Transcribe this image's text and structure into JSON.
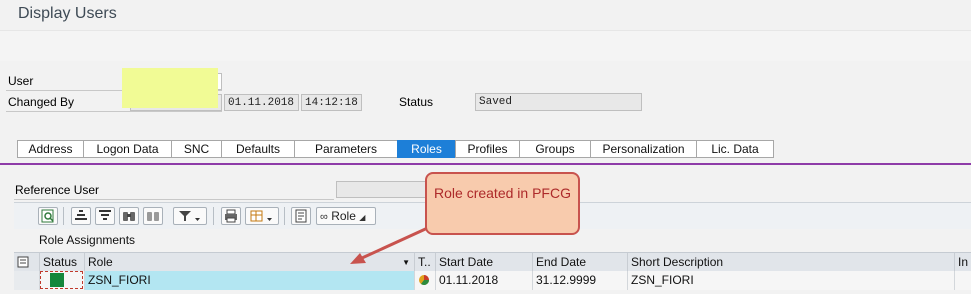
{
  "window": {
    "title": "Display Users"
  },
  "header": {
    "user_label": "User",
    "changed_by_label": "Changed By",
    "changed_date": "01.11.2018",
    "changed_time": "14:12:18",
    "status_label": "Status",
    "status_value": "Saved"
  },
  "tabs": [
    {
      "label": "Address"
    },
    {
      "label": "Logon Data"
    },
    {
      "label": "SNC"
    },
    {
      "label": "Defaults"
    },
    {
      "label": "Parameters"
    },
    {
      "label": "Roles"
    },
    {
      "label": "Profiles"
    },
    {
      "label": "Groups"
    },
    {
      "label": "Personalization"
    },
    {
      "label": "Lic. Data"
    }
  ],
  "active_tab": "Roles",
  "reference_user": {
    "label": "Reference User"
  },
  "toolbar": {
    "role_button_label": "Role"
  },
  "section_title": "Role Assignments",
  "table": {
    "headers": [
      "Status",
      "Role",
      "T..",
      "Start Date",
      "End Date",
      "Short Description",
      "In"
    ],
    "rows": [
      {
        "role": "ZSN_FIORI",
        "start_date": "01.11.2018",
        "end_date": "31.12.9999",
        "short_description": "ZSN_FIORI"
      }
    ]
  },
  "annotation": {
    "text": "Role created in PFCG"
  },
  "colors": {
    "active_tab": "#1d7fd8",
    "tab_separator": "#8e3ca8",
    "highlight": "#f1fb95",
    "status_green": "#14873c",
    "row_highlight": "#b3e6f2",
    "callout_fill": "#f8cbad",
    "callout_border": "#c8534e"
  }
}
